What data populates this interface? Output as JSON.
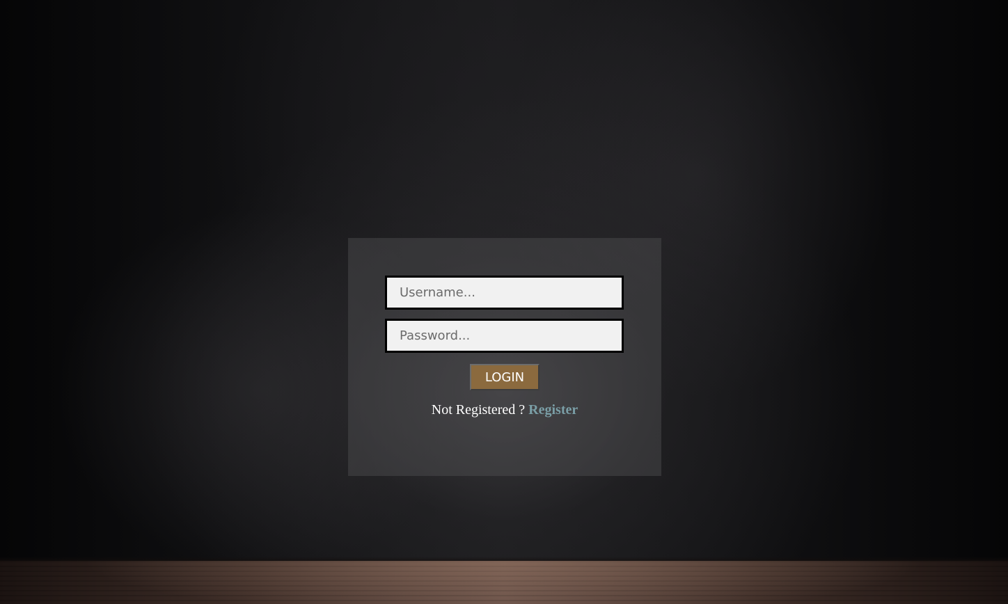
{
  "login_form": {
    "username_placeholder": "Username...",
    "password_placeholder": "Password...",
    "login_label": "LOGIN",
    "not_registered_text": "Not Registered ?",
    "register_label": "Register"
  },
  "colors": {
    "login_button": "#8b6a3e",
    "register_link": "#7a9ea6",
    "field_background": "#f1f1f1"
  }
}
